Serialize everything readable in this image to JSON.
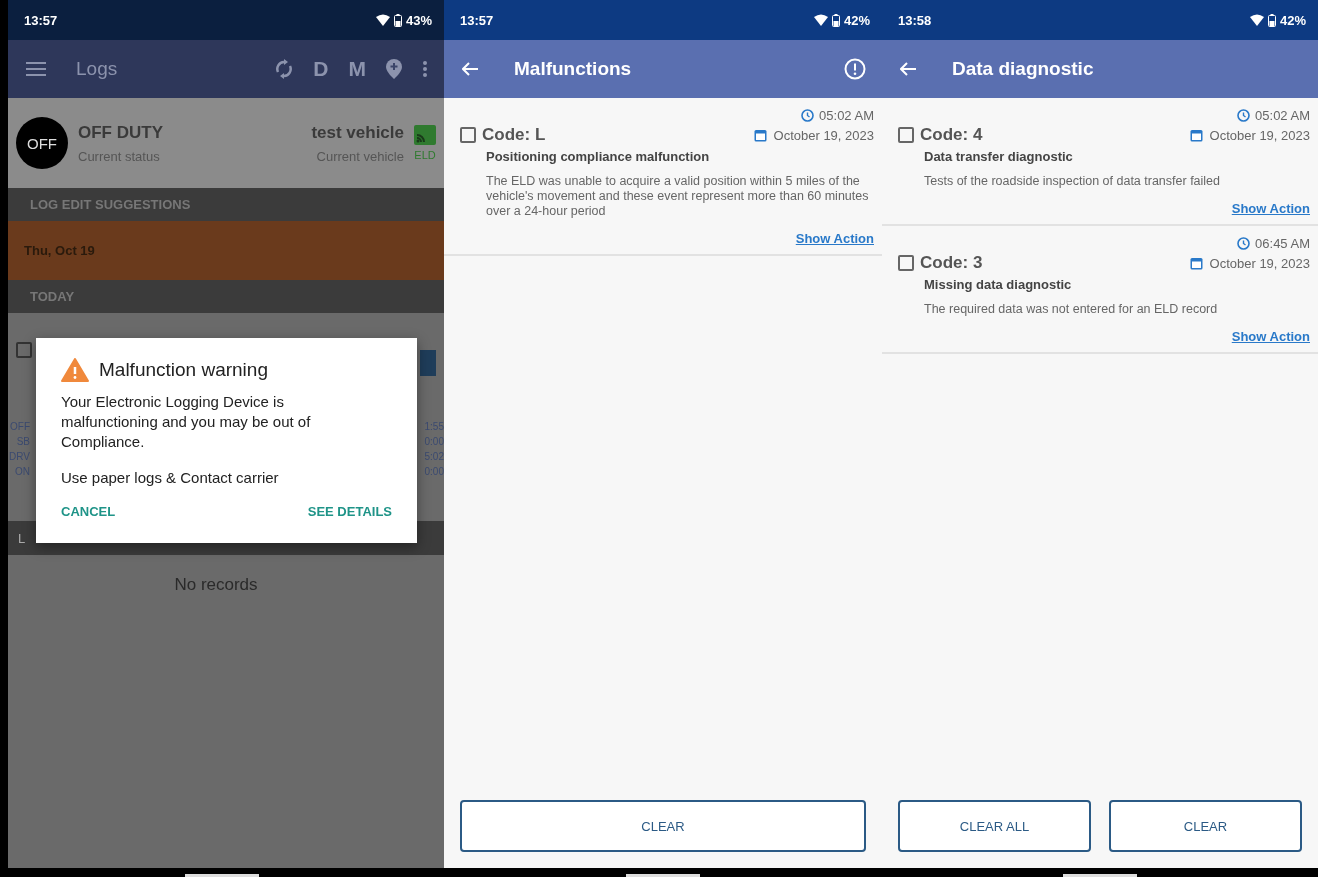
{
  "screens": [
    {
      "kind": "logs",
      "status_bar": {
        "time": "13:57",
        "battery": "43%"
      },
      "toolbar": {
        "title": "Logs",
        "actions": [
          "D",
          "M"
        ]
      },
      "duty": {
        "badge": "OFF",
        "status": "OFF DUTY",
        "status_label": "Current status",
        "vehicle": "test vehicle",
        "vehicle_label": "Current vehicle",
        "eld": "ELD"
      },
      "suggestions_header": "LOG EDIT SUGGESTIONS",
      "suggestion": "Thu, Oct 19",
      "today_header": "TODAY",
      "today_checked": false,
      "stats": [
        {
          "label": "OFF",
          "value": "1:55"
        },
        {
          "label": "SB",
          "value": "0:00"
        },
        {
          "label": "DRV",
          "value": "5:02"
        },
        {
          "label": "ON",
          "value": "0:00"
        }
      ],
      "logs_header": "L",
      "empty": "No records",
      "dialog": {
        "title": "Malfunction warning",
        "message": "Your Electronic Logging Device is malfunctioning and you may be out of Compliance.",
        "instruction": "Use paper logs & Contact carrier",
        "buttons": [
          "CANCEL",
          "SEE DETAILS"
        ]
      }
    },
    {
      "kind": "list",
      "status_bar": {
        "time": "13:57",
        "battery": "42%"
      },
      "toolbar": {
        "title": "Malfunctions",
        "info": true
      },
      "items": [
        {
          "code": "Code: L",
          "time": "05:02 AM",
          "date": "October 19, 2023",
          "title": "Positioning compliance malfunction",
          "description": "The ELD was unable to acquire a valid position within 5 miles of the vehicle's movement and these event represent more than 60 minutes over a 24-hour period",
          "action": "Show Action",
          "checked": false
        }
      ],
      "buttons": [
        "CLEAR"
      ]
    },
    {
      "kind": "list",
      "status_bar": {
        "time": "13:58",
        "battery": "42%"
      },
      "toolbar": {
        "title": "Data diagnostic",
        "info": false
      },
      "items": [
        {
          "code": "Code: 4",
          "time": "05:02 AM",
          "date": "October 19, 2023",
          "title": "Data transfer diagnostic",
          "description": "Tests of the roadside inspection of data transfer failed",
          "action": "Show Action",
          "checked": false
        },
        {
          "code": "Code: 3",
          "time": "06:45 AM",
          "date": "October 19, 2023",
          "title": "Missing data diagnostic",
          "description": "The required data was not entered for an ELD record",
          "action": "Show Action",
          "checked": false
        }
      ],
      "buttons": [
        "CLEAR ALL",
        "CLEAR"
      ]
    }
  ]
}
